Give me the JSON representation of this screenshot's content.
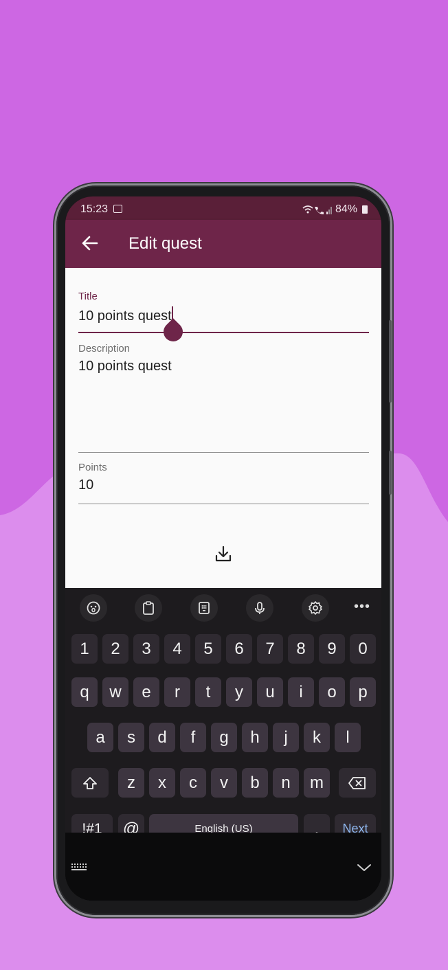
{
  "status_bar": {
    "time": "15:23",
    "battery": "84%",
    "signal_icons": "wifi-call signal"
  },
  "app_bar": {
    "title": "Edit quest"
  },
  "form": {
    "title": {
      "label": "Title",
      "value": "10 points quest"
    },
    "description": {
      "label": "Description",
      "value": "10 points quest"
    },
    "points": {
      "label": "Points",
      "value": "10"
    }
  },
  "keyboard": {
    "toolbar_icons": [
      "emoji-icon",
      "clipboard-icon",
      "keypad-icon",
      "mic-icon",
      "settings-icon",
      "more-icon"
    ],
    "toolbar_more": "•••",
    "row_numbers": [
      "1",
      "2",
      "3",
      "4",
      "5",
      "6",
      "7",
      "8",
      "9",
      "0"
    ],
    "row1": [
      "q",
      "w",
      "e",
      "r",
      "t",
      "y",
      "u",
      "i",
      "o",
      "p"
    ],
    "row2": [
      "a",
      "s",
      "d",
      "f",
      "g",
      "h",
      "j",
      "k",
      "l"
    ],
    "row3": [
      "z",
      "x",
      "c",
      "v",
      "b",
      "n",
      "m"
    ],
    "symbols_label": "!#1",
    "at_label": "@",
    "space_label": "English (US)",
    "period_label": ".",
    "action_label": "Next"
  },
  "colors": {
    "accent": "#6e2549",
    "status_bar": "#5a1f38",
    "background": "#cd67e3",
    "background_light": "#dc8ded",
    "action_key_text": "#8fb7ee"
  }
}
